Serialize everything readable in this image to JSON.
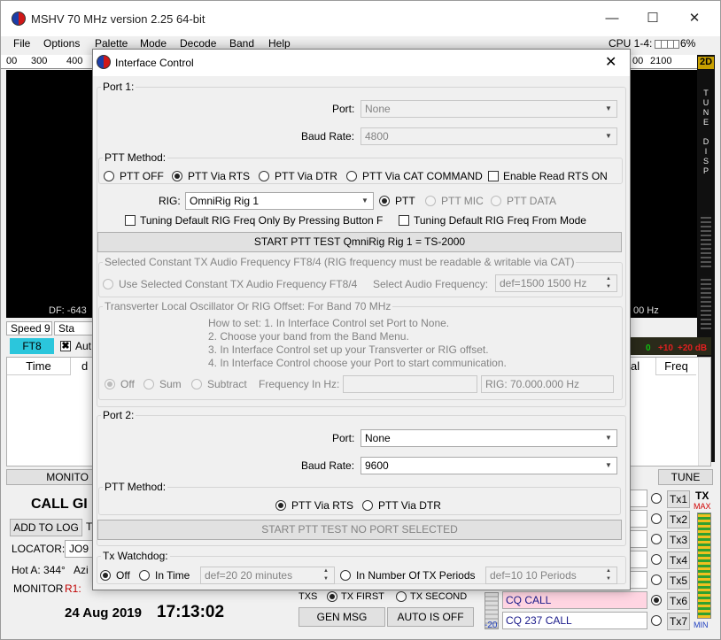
{
  "main_window": {
    "title": "MSHV 70 MHz version 2.25 64-bit",
    "minimize": "—",
    "maximize": "☐",
    "close": "✕",
    "menu": [
      "File",
      "Options",
      "Palette",
      "Mode",
      "Decode",
      "Band",
      "Help"
    ],
    "cpu_label": "CPU 1-4:",
    "cpu_value": "6%",
    "scale_ticks": [
      "00",
      "300",
      "400",
      "00",
      "2100"
    ],
    "side_2d": "2D",
    "side_letters": [
      "T",
      "U",
      "N",
      "E",
      "D",
      "I",
      "S",
      "P"
    ],
    "df_text": "DF: -643",
    "hz_text": "00 Hz",
    "speed": "Speed 9",
    "sta": "Sta",
    "mode_badge": "FT8",
    "auto_check_label": "Aut",
    "col_time": "Time",
    "col_d": "d",
    "col_al": "al",
    "col_freq": "Freq",
    "db_labels": [
      "0",
      "+10",
      "+20 dB"
    ],
    "monitor_btn": "MONITO",
    "tune_btn": "TUNE",
    "call_text": "CALL GI",
    "add_to_log": "ADD TO LOG",
    "add_t": "T",
    "locator_label": "LOCATOR:",
    "locator_value": "JO9",
    "hot_a": "Hot A: 344°",
    "azi": "Azi",
    "monitor_label": "MONITOR",
    "r1": "R1:",
    "date": "24 Aug 2019",
    "time": "17:13:02",
    "tx_first": "TX FIRST",
    "tx_second": "TX SECOND",
    "txs": "TXS",
    "gen_msg": "GEN MSG",
    "auto_is_off": "AUTO IS OFF",
    "cq_call_1": "CQ CALL",
    "cq_call_2": "CQ 237 CALL",
    "tx_buttons": [
      "Tx1",
      "Tx2",
      "Tx3",
      "Tx4",
      "Tx5",
      "Tx6",
      "Tx7"
    ],
    "tx_label": "TX",
    "tx_max": "MAX",
    "tx_min": "MIN",
    "minus20": "-20"
  },
  "dialog": {
    "title": "Interface Control",
    "close": "✕",
    "port1": {
      "group_title": "Port 1:",
      "port_label": "Port:",
      "port_value": "None",
      "baud_label": "Baud Rate:",
      "baud_value": "4800",
      "ptt_method_title": "PTT Method:",
      "ptt_options": [
        "PTT OFF",
        "PTT Via RTS",
        "PTT Via DTR",
        "PTT Via CAT COMMAND"
      ],
      "enable_read_rts": "Enable Read RTS ON",
      "rig_label": "RIG:",
      "rig_value": "OmniRig Rig 1",
      "rig_ptt_options": [
        "PTT",
        "PTT MIC",
        "PTT DATA"
      ],
      "tuning_default_button": "Tuning Default RIG Freq Only By Pressing Button F",
      "tuning_default_mode": "Tuning Default RIG Freq From Mode",
      "start_ptt_test": "START PTT TEST  QmniRig Rig 1 = TS-2000",
      "const_tx_group": "Selected Constant TX Audio Frequency FT8/4 (RIG frequency must be readable & writable via CAT)",
      "use_const_tx": "Use Selected Constant TX Audio Frequency FT8/4",
      "select_audio_label": "Select  Audio Frequency:",
      "audio_value": "def=1500  1500  Hz",
      "transverter_group": "Transverter Local Oscillator Or RIG Offset:   For Band 70 MHz",
      "howto": [
        "How to set: 1. In Interface Control set Port to None.",
        "2. Choose your band from the Band Menu.",
        "3. In Interface Control set up your Transverter or RIG offset.",
        "4. In Interface Control choose your Port to start communication."
      ],
      "offset_options": [
        "Off",
        "Sum",
        "Subtract"
      ],
      "freq_in_hz_label": "Frequency In Hz:",
      "freq_in_hz_value": "",
      "rig_freq_value": "RIG: 70.000.000 Hz"
    },
    "port2": {
      "group_title": "Port 2:",
      "port_label": "Port:",
      "port_value": "None",
      "baud_label": "Baud Rate:",
      "baud_value": "9600",
      "ptt_method_title": "PTT Method:",
      "ptt_options": [
        "PTT Via RTS",
        "PTT Via DTR"
      ],
      "start_ptt_test": "START PTT TEST    NO PORT SELECTED"
    },
    "watchdog": {
      "title": "Tx Watchdog:",
      "options": [
        "Off",
        "In Time",
        "In Number Of TX Periods"
      ],
      "time_value": "def=20  20  minutes",
      "periods_value": "def=10  10  Periods"
    }
  },
  "colors": {
    "waterfall": "#000000",
    "mode_badge_bg": "#2bc6dc",
    "cq_call_bg": "#ffd5e2",
    "db_green": "#10c010",
    "db_red": "#e02020"
  },
  "icons": {
    "app_logo": "mshv-logo-icon",
    "dropdown": "chevron-down-icon",
    "spin": "spin-arrows-icon"
  }
}
